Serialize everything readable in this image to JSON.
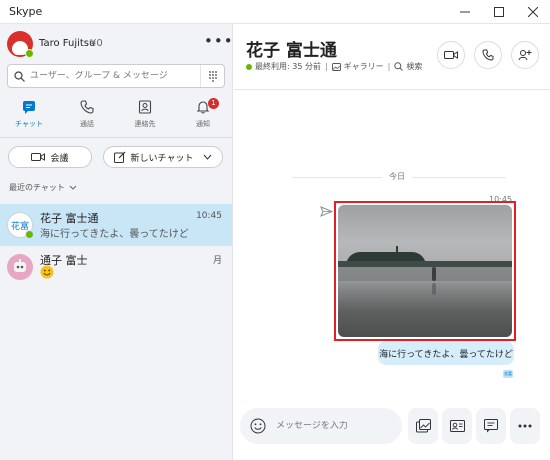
{
  "window": {
    "title": "Skype",
    "controls": [
      "minimize",
      "maximize",
      "close"
    ]
  },
  "profile": {
    "name": "Taro Fujitsu",
    "credit": "¥0",
    "more_icon": "more-horizontal-icon"
  },
  "search": {
    "placeholder": "ユーザー、グループ & メッセージ"
  },
  "nav_tabs": [
    {
      "label": "チャット",
      "icon": "chat-icon",
      "active": true
    },
    {
      "label": "通話",
      "icon": "phone-icon"
    },
    {
      "label": "連絡先",
      "icon": "contacts-icon"
    },
    {
      "label": "通知",
      "icon": "bell-icon",
      "badge": "1"
    }
  ],
  "actions": {
    "meet_label": "会議",
    "new_chat_label": "新しいチャット"
  },
  "recent_header": "最近のチャット",
  "chats": [
    {
      "avatar_text": "花富",
      "name": "花子 富士通",
      "last_message": "海に行ってきたよ、曇ってたけど",
      "time": "10:45",
      "selected": true
    },
    {
      "avatar_text": "",
      "name": "通子 富士",
      "last_message": "",
      "time": "月",
      "selected": false
    }
  ],
  "conversation": {
    "title": "花子 富士通",
    "last_seen": "最終利用: 35 分前",
    "gallery_label": "ギャラリー",
    "search_label": "検索",
    "separator": "|",
    "date_divider": "今日",
    "message_time": "10:45",
    "message_text": "海に行ってきたよ、曇ってたけど",
    "read_mark": "花富"
  },
  "composer": {
    "placeholder": "メッセージを入力"
  },
  "colors": {
    "accent": "#0078d4",
    "selected_chat": "#c9e6f6",
    "bubble": "#d6eefb",
    "highlight_border": "#e01f26",
    "presence": "#6bb700",
    "badge": "#d92c2c"
  }
}
